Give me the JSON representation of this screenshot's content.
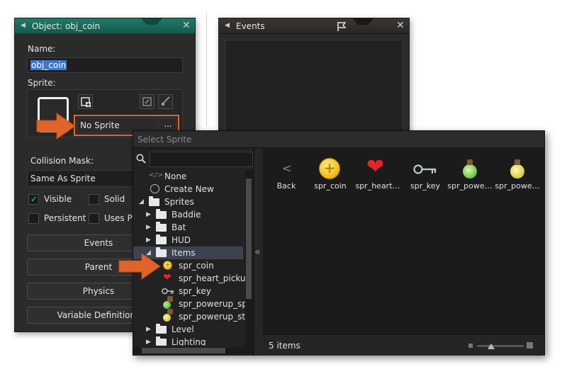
{
  "object_window": {
    "title": "Object: obj_coin",
    "name_label": "Name:",
    "name_value": "obj_coin",
    "sprite_label": "Sprite:",
    "sprite_value": "No Sprite",
    "sprite_menu": "...",
    "collision_label": "Collision Mask:",
    "collision_value": "Same As Sprite",
    "checkboxes": [
      {
        "label": "Visible",
        "checked": true
      },
      {
        "label": "Solid",
        "checked": false
      },
      {
        "label": "Persistent",
        "checked": false
      },
      {
        "label": "Uses Pl",
        "checked": false
      }
    ],
    "buttons": [
      "Events",
      "Parent",
      "Physics",
      "Variable Definitions"
    ]
  },
  "events_window": {
    "title": "Events"
  },
  "select_sprite": {
    "title": "Select Sprite",
    "search_value": "",
    "collapse_glyph": "«",
    "tree": [
      {
        "label": "None"
      },
      {
        "label": "Create New"
      },
      {
        "label": "Sprites"
      },
      {
        "label": "Baddie"
      },
      {
        "label": "Bat"
      },
      {
        "label": "HUD"
      },
      {
        "label": "Items"
      },
      {
        "label": "spr_coin"
      },
      {
        "label": "spr_heart_pickup"
      },
      {
        "label": "spr_key"
      },
      {
        "label": "spr_powerup_spe"
      },
      {
        "label": "spr_powerup_sta"
      },
      {
        "label": "Level"
      },
      {
        "label": "Lighting"
      }
    ],
    "tiles": [
      {
        "label": "Back",
        "icon": "back-chevron"
      },
      {
        "label": "spr_coin",
        "icon": "coin"
      },
      {
        "label": "spr_heart…",
        "icon": "heart"
      },
      {
        "label": "spr_key",
        "icon": "key"
      },
      {
        "label": "spr_powe…",
        "icon": "green-potion"
      },
      {
        "label": "spr_powe…",
        "icon": "yellow-potion"
      }
    ],
    "item_count": "5 items"
  },
  "colors": {
    "object_titlebar": "#1f7a6a",
    "highlight_orange": "#e0642a",
    "selection_row": "#3c4250"
  }
}
